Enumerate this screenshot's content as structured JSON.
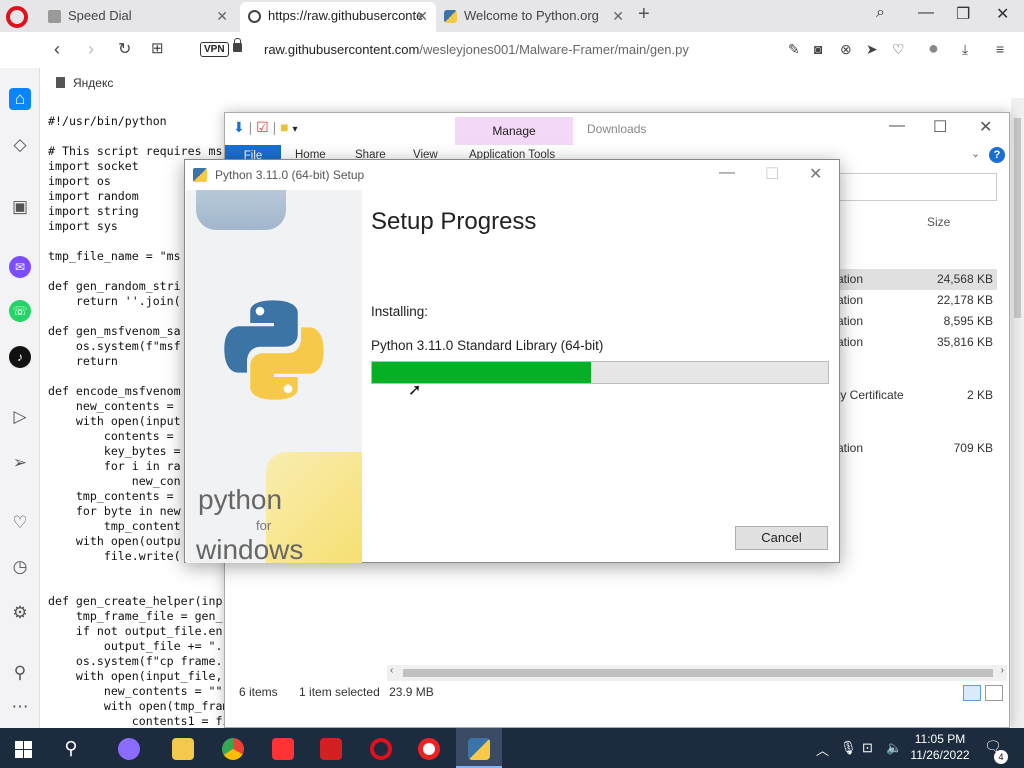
{
  "browser": {
    "tabs": [
      {
        "title": "Speed Dial",
        "icon": "speed-dial-icon"
      },
      {
        "title": "https://raw.githubuserconte",
        "icon": "globe-icon"
      },
      {
        "title": "Welcome to Python.org",
        "icon": "python-icon"
      }
    ],
    "address": {
      "vpn_label": "VPN",
      "domain": "raw.githubusercontent.com",
      "path": "/wesleyjones001/Malware-Framer/main/gen.py"
    },
    "bookmark": "Яндекс"
  },
  "code_lines": [
    "#!/usr/bin/python",
    "",
    "# This script requires ms",
    "import socket",
    "import os",
    "import random",
    "import string",
    "import sys",
    "",
    "tmp_file_name = \"ms",
    "",
    "def gen_random_stri",
    "    return ''.join(",
    "",
    "def gen_msfvenom_sa",
    "    os.system(f\"msf",
    "    return",
    "",
    "def encode_msfvenom",
    "    new_contents =",
    "    with open(input",
    "        contents =",
    "        key_bytes =",
    "        for i in ra",
    "            new_con",
    "    tmp_contents =",
    "    for byte in new",
    "        tmp_content",
    "    with open(outpu",
    "        file.write(",
    "",
    "",
    "def gen_create_helper(inp",
    "    tmp_frame_file = gen_",
    "    if not output_file.en",
    "        output_file += \".",
    "    os.system(f\"cp frame.",
    "    with open(input_file,",
    "        new_contents = \"\"",
    "        with open(tmp_frame_file, \"r\") as file2:",
    "            contents1 = file1.read()"
  ],
  "explorer": {
    "ribbon_manage": "Manage",
    "title": "Downloads",
    "ribbon_tabs": [
      "File",
      "Home",
      "Share",
      "View",
      "Application Tools"
    ],
    "column_size": "Size",
    "rows": [
      {
        "type": "ation",
        "size": "24,568 KB",
        "selected": true
      },
      {
        "type": "ation",
        "size": "22,178 KB",
        "selected": false
      },
      {
        "type": "ation",
        "size": "8,595 KB",
        "selected": false
      },
      {
        "type": "ation",
        "size": "35,816 KB",
        "selected": false
      },
      {
        "type": "ty Certificate",
        "size": "2 KB",
        "selected": false
      },
      {
        "type": "ation",
        "size": "709 KB",
        "selected": false
      }
    ],
    "status": {
      "items": "6 items",
      "selected": "1 item selected",
      "size": "23.9 MB"
    }
  },
  "setup": {
    "window_title": "Python 3.11.0 (64-bit) Setup",
    "heading": "Setup Progress",
    "installing_label": "Installing:",
    "component": "Python 3.11.0 Standard Library (64-bit)",
    "progress_fraction": 0.48,
    "cancel_label": "Cancel",
    "brand_python": "python",
    "brand_for": "for",
    "brand_windows": "windows"
  },
  "taskbar": {
    "time": "11:05 PM",
    "date": "11/26/2022",
    "notification_count": "4"
  },
  "colors": {
    "progress_fill": "#06b025",
    "manage_tab": "#f4d8f7",
    "file_tab": "#1a6fd1",
    "opera_red": "#e0111c"
  }
}
